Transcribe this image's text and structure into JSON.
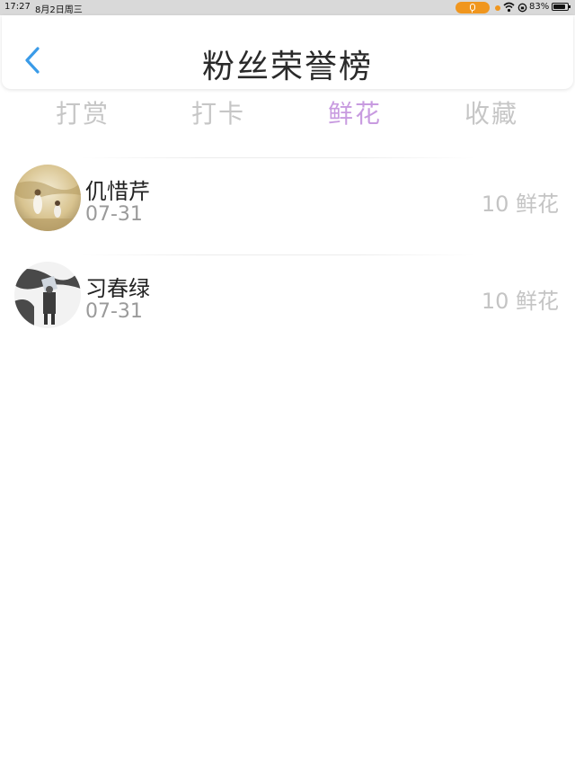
{
  "status_bar": {
    "time": "17:27",
    "date": "8月2日周三",
    "battery": "83%"
  },
  "header": {
    "title": "粉丝荣誉榜"
  },
  "tabs": [
    {
      "label": "打赏",
      "active": false
    },
    {
      "label": "打卡",
      "active": false
    },
    {
      "label": "鲜花",
      "active": true
    },
    {
      "label": "收藏",
      "active": false
    }
  ],
  "list": [
    {
      "name": "仉惜芹",
      "date": "07-31",
      "amount": "10 鲜花"
    },
    {
      "name": "习春绿",
      "date": "07-31",
      "amount": "10 鲜花"
    }
  ],
  "colors": {
    "active_tab": "#c89be0",
    "back_arrow": "#3a9be8",
    "status_mic": "#f0961e"
  }
}
